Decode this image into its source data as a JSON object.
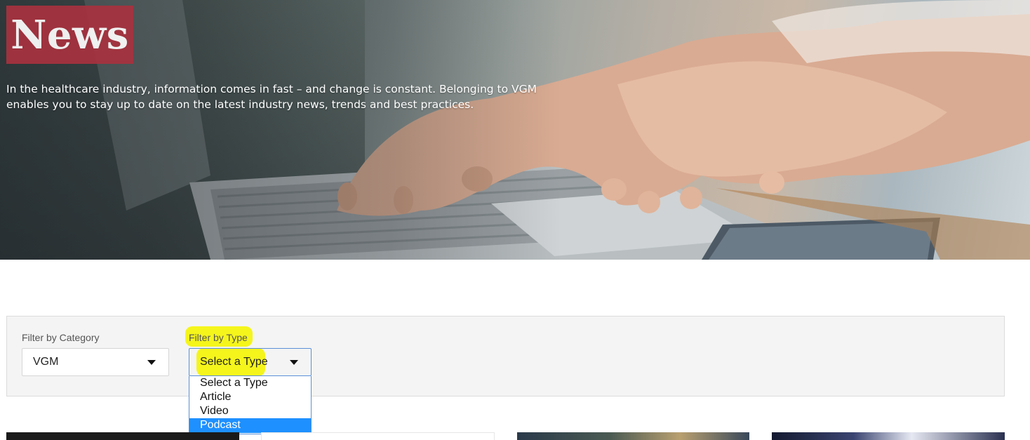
{
  "hero": {
    "badge": "News",
    "description": "In the healthcare industry, information comes in fast – and change is constant. Belonging to VGM enables you to stay up to date on the latest industry news, trends and best practices."
  },
  "filters": {
    "category": {
      "label": "Filter by Category",
      "value": "VGM",
      "icon": "chevron-down-icon"
    },
    "type": {
      "label": "Filter by Type",
      "value": "Select a Type",
      "icon": "chevron-down-icon",
      "options": [
        "Select a Type",
        "Article",
        "Video",
        "Podcast"
      ],
      "highlighted_option": "Podcast"
    }
  },
  "colors": {
    "badge": "#a8323f",
    "highlighter": "#f5f51c",
    "option_highlight": "#1e90ff",
    "focus_border": "#5b8fd6"
  }
}
